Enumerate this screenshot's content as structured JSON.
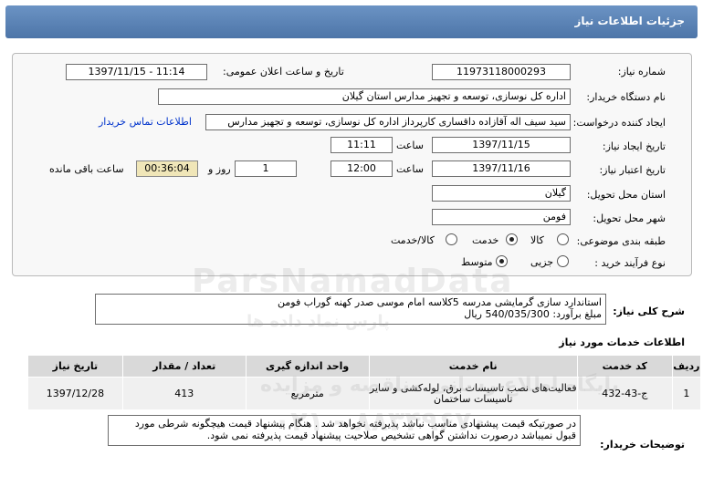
{
  "header": {
    "title": "جزئیات اطلاعات نیاز"
  },
  "form": {
    "need_number_label": "شماره نیاز:",
    "need_number": "11973118000293",
    "announce_label": "تاریخ و ساعت اعلان عمومی:",
    "announce_value": "1397/11/15 - 11:14",
    "buyer_org_label": "نام دستگاه خریدار:",
    "buyer_org": "اداره کل نوسازی، توسعه و تجهیز مدارس استان گیلان",
    "requester_label": "ایجاد کننده درخواست:",
    "requester": "سید سیف اله آقازاده داقساری کارپرداز اداره کل نوسازی، توسعه و تجهیز مدارس",
    "contact_link": "اطلاعات تماس خریدار",
    "create_date_label": "تاریخ ایجاد نیاز:",
    "create_date": "1397/11/15",
    "hour_label": "ساعت",
    "create_time": "11:11",
    "valid_date_label": "تاریخ اعتبار نیاز:",
    "valid_date": "1397/11/16",
    "valid_time": "12:00",
    "day_label": "روز و",
    "days": "1",
    "remaining_time": "00:36:04",
    "remaining_label": "ساعت باقی مانده",
    "province_label": "استان محل تحویل:",
    "province": "گیلان",
    "city_label": "شهر محل تحویل:",
    "city": "فومن",
    "category_label": "طبقه بندی موضوعی:",
    "category_options": [
      "کالا",
      "خدمت",
      "کالا/خدمت"
    ],
    "category_selected": "خدمت",
    "process_label": "نوع فرآیند خرید :",
    "process_options": [
      "جزیی",
      "متوسط"
    ],
    "process_selected": "متوسط"
  },
  "description": {
    "label": "شرح کلی نیاز:",
    "line1": "استاندارد سازی گرمایشی مدرسه 5کلاسه امام موسی صدر کهنه گوراب فومن",
    "line2": "مبلغ برآورد: 540/035/300 ریال"
  },
  "services": {
    "title": "اطلاعات خدمات مورد نیاز",
    "columns": [
      "ردیف",
      "کد خدمت",
      "نام خدمت",
      "واحد اندازه گیری",
      "تعداد / مقدار",
      "تاریخ نیاز"
    ],
    "rows": [
      [
        "1",
        "ج-43-432",
        "فعالیت‌های نصب تاسیسات برق، لوله‌کشی و سایر تاسیسات ساختمان",
        "مترمربع",
        "413",
        "1397/12/28"
      ]
    ]
  },
  "buyer_notes": {
    "label": "توضیحات خریدار:",
    "text": "در صورتیکه قیمت پیشنهادی مناسب نباشد پذیرفته نخواهد شد . هنگام پیشنهاد قیمت هیچگونه شرطی مورد قبول نمیباشد    درصورت نداشتن گواهی تشخیص صلاحیت پیشنهاد قیمت پذیرفته نمی شود."
  },
  "watermark": {
    "brand": "ParsNamadData",
    "line1": "پایگاه اطلاع رسانی مناقصه و مزایده",
    "line2": "پارس نماد داده ها",
    "phone": "۰۲۱ - ۸۸۳۴۹۶۷۰"
  }
}
